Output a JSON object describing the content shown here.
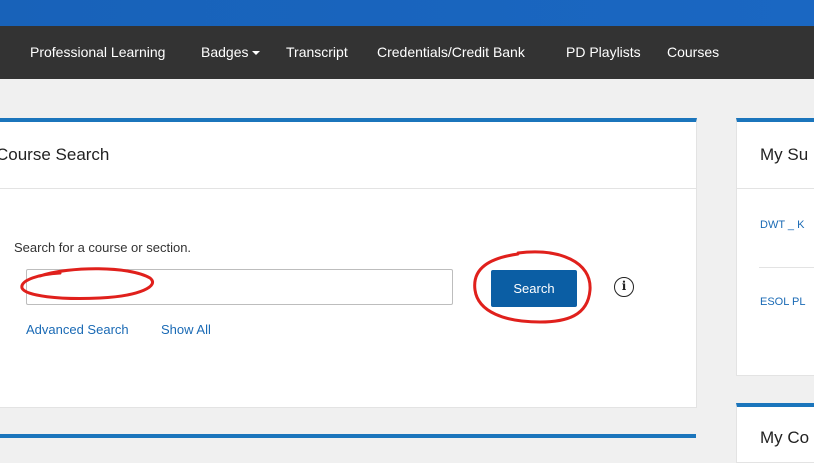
{
  "nav": {
    "items": [
      {
        "label": "Professional Learning"
      },
      {
        "label": "Badges"
      },
      {
        "label": "Transcript"
      },
      {
        "label": "Credentials/Credit Bank"
      },
      {
        "label": "PD Playlists"
      },
      {
        "label": "Courses"
      }
    ]
  },
  "course_search": {
    "title": "Course Search",
    "label": "Search for a course or section.",
    "input_value": "",
    "search_button": "Search",
    "advanced_link": "Advanced Search",
    "show_all_link": "Show All"
  },
  "side_panel": {
    "title": "My Su",
    "items": [
      "DWT _ K",
      "ESOL PL"
    ],
    "bottom_title": "My Co"
  },
  "colors": {
    "accent": "#1b75bc",
    "button": "#0b5ea4",
    "annotation": "#e0201c"
  }
}
